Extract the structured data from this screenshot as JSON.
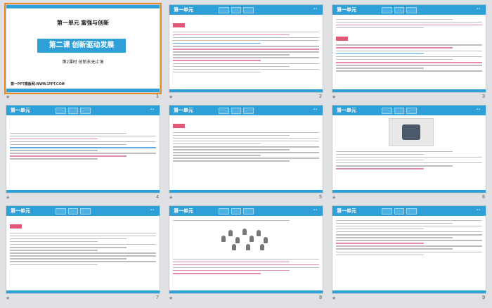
{
  "slides": [
    {
      "number": "1",
      "unit": "第一单元    富强与创新",
      "lesson": "第二课    创新驱动发展",
      "period": "第2课时    创新永无止境",
      "brand": "第一PPT模板网-WWW.1PPT.COM"
    },
    {
      "number": "2",
      "header": "第一单元"
    },
    {
      "number": "3",
      "header": "第一单元"
    },
    {
      "number": "4",
      "header": "第一单元"
    },
    {
      "number": "5",
      "header": "第一单元"
    },
    {
      "number": "6",
      "header": "第一单元"
    },
    {
      "number": "7",
      "header": "第一单元"
    },
    {
      "number": "8",
      "header": "第一单元"
    },
    {
      "number": "9",
      "header": "第一单元"
    }
  ],
  "colors": {
    "accent": "#2f9fd8",
    "highlight": "#e05a78",
    "selection": "#e48b2c"
  }
}
